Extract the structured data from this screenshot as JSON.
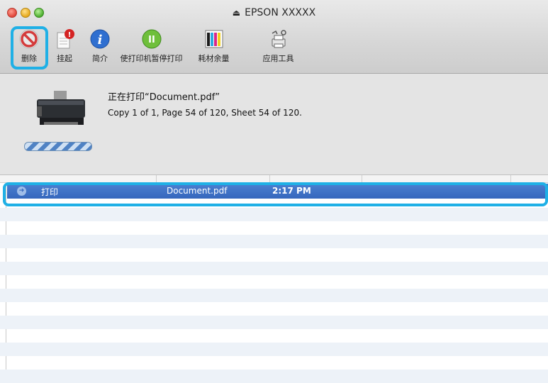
{
  "window": {
    "title": "EPSON XXXXX",
    "eject_glyph": "⏏"
  },
  "toolbar": {
    "items": [
      {
        "label": "删除",
        "icon": "delete-icon"
      },
      {
        "label": "挂起",
        "icon": "hold-icon"
      },
      {
        "label": "简介",
        "icon": "info-icon"
      },
      {
        "label": "使打印机暂停打印",
        "icon": "pause-icon"
      },
      {
        "label": "耗材余量",
        "icon": "supply-levels-icon"
      },
      {
        "label": "应用工具",
        "icon": "utility-icon"
      }
    ],
    "hold_badge": "!",
    "info_glyph": "i",
    "pause_glyph": "II"
  },
  "job_info": {
    "title": "正在打印“Document.pdf”",
    "detail": "Copy 1 of 1, Page 54 of 120, Sheet 54 of 120."
  },
  "queue": {
    "rows": [
      {
        "status": "打印",
        "name": "Document.pdf",
        "time": "2:17 PM"
      }
    ],
    "row_arrow": "➜"
  },
  "colors": {
    "highlight": "#1fb0e6",
    "selection": "#3667bd"
  }
}
